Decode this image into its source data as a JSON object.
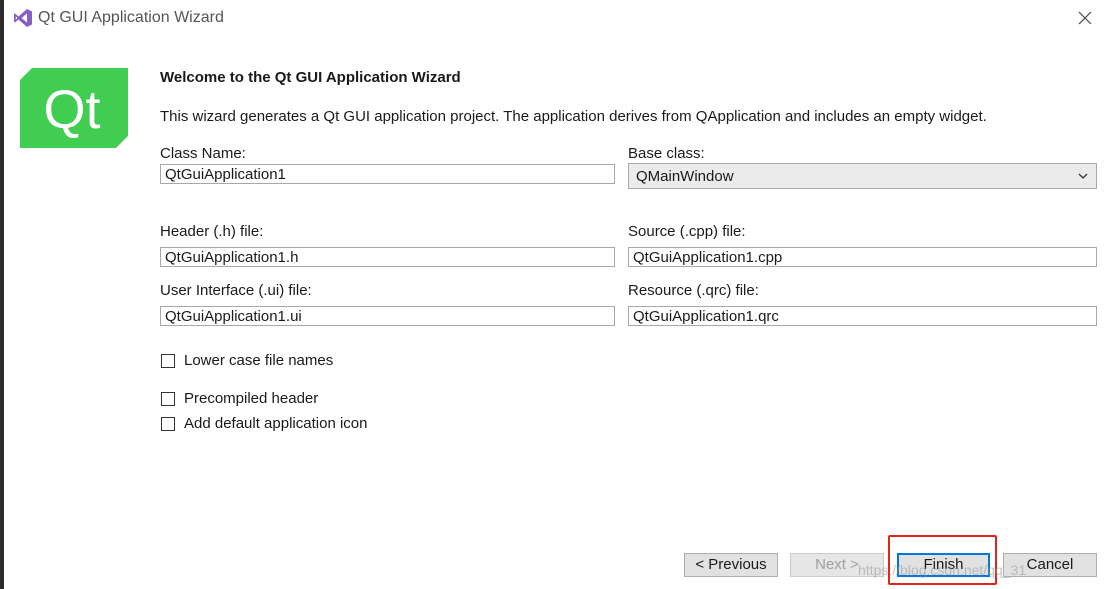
{
  "window": {
    "title": "Qt GUI Application Wizard"
  },
  "logo": {
    "text": "Qt",
    "color": "#41cd52"
  },
  "heading": "Welcome to the Qt GUI Application Wizard",
  "description": "This wizard generates a Qt GUI application project. The application derives from QApplication and includes an empty widget.",
  "form": {
    "class_name": {
      "label": "Class Name:",
      "value": "QtGuiApplication1"
    },
    "base_class": {
      "label": "Base class:",
      "value": "QMainWindow"
    },
    "header_file": {
      "label": "Header (.h) file:",
      "value": "QtGuiApplication1.h"
    },
    "source_file": {
      "label": "Source (.cpp) file:",
      "value": "QtGuiApplication1.cpp"
    },
    "ui_file": {
      "label": "User Interface (.ui) file:",
      "value": "QtGuiApplication1.ui"
    },
    "resource_file": {
      "label": "Resource (.qrc) file:",
      "value": "QtGuiApplication1.qrc"
    }
  },
  "options": {
    "lower_case": {
      "label": "Lower case file names",
      "checked": false
    },
    "precompiled": {
      "label": "Precompiled header",
      "checked": false
    },
    "default_icon": {
      "label": "Add default application icon",
      "checked": false
    }
  },
  "buttons": {
    "previous": "< Previous",
    "next": "Next >",
    "finish": "Finish",
    "cancel": "Cancel"
  },
  "watermark": "https://blog.csdn.net/qq_31"
}
